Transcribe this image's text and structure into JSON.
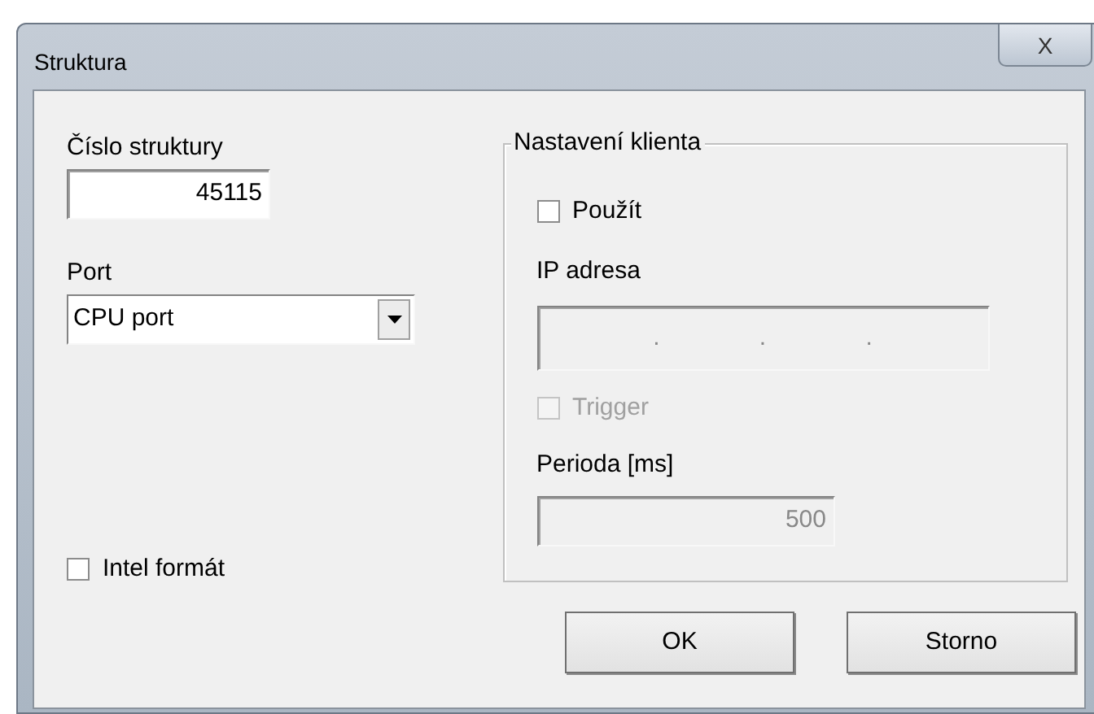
{
  "window": {
    "title": "Struktura",
    "close": "X"
  },
  "structure_number": {
    "label": "Číslo struktury",
    "value": "45115"
  },
  "port": {
    "label": "Port",
    "value": "CPU port"
  },
  "intel_format": {
    "label": "Intel formát",
    "checked": false,
    "disabled": false
  },
  "client_settings": {
    "title": "Nastavení klienta",
    "use": {
      "label": "Použít",
      "checked": false,
      "disabled": false
    },
    "ip_address": {
      "label": "IP adresa",
      "separators": [
        ".",
        ".",
        "."
      ],
      "disabled": true
    },
    "trigger": {
      "label": "Trigger",
      "checked": false,
      "disabled": true
    },
    "period": {
      "label": "Perioda [ms]",
      "value": "500",
      "disabled": true
    }
  },
  "buttons": [
    "OK",
    "Storno"
  ]
}
